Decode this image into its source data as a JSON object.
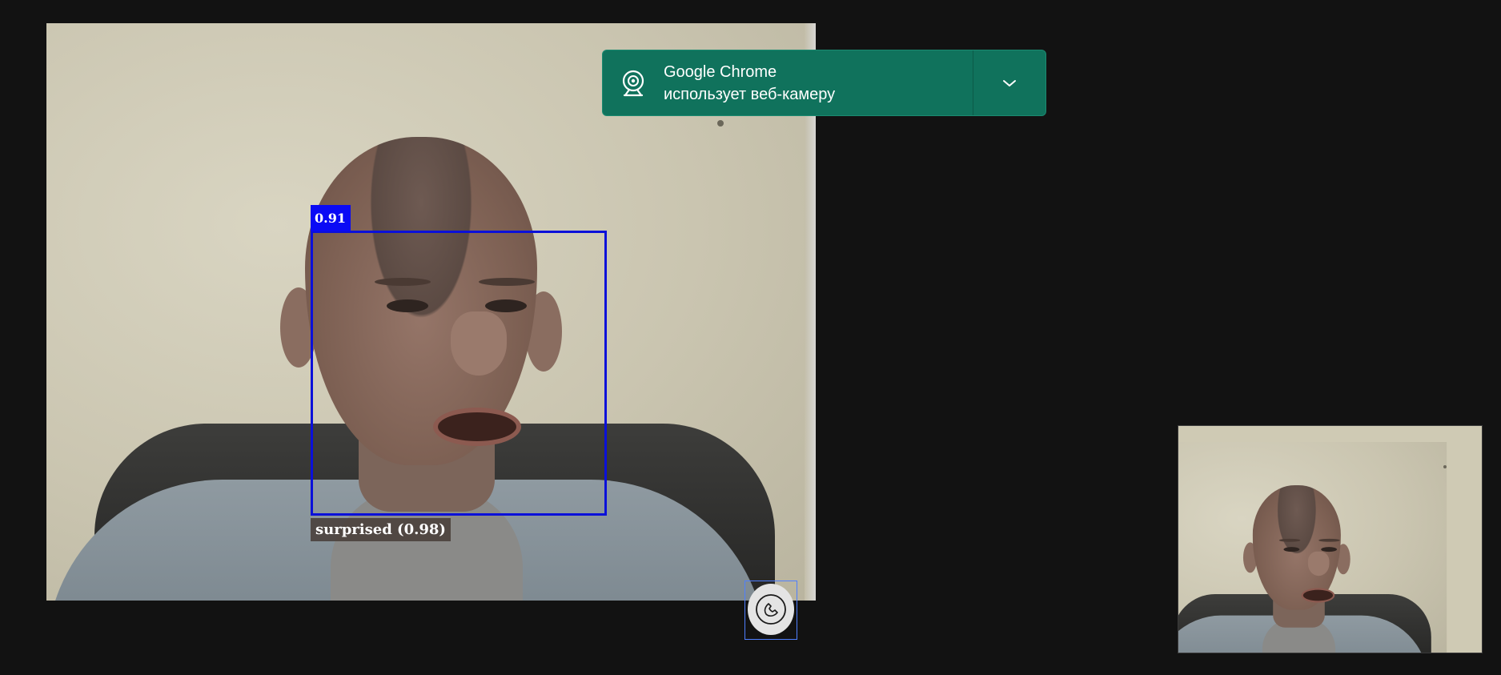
{
  "video": {
    "detection": {
      "score": "0.91",
      "label": "surprised (0.98)",
      "box_color": "#0b10d9"
    }
  },
  "notification": {
    "title": "Google Chrome",
    "message": "использует веб-камеру",
    "icon": "webcam-icon",
    "expand_icon": "chevron-down-icon",
    "background": "#10725c"
  },
  "controls": {
    "end_call_icon": "phone-icon"
  }
}
